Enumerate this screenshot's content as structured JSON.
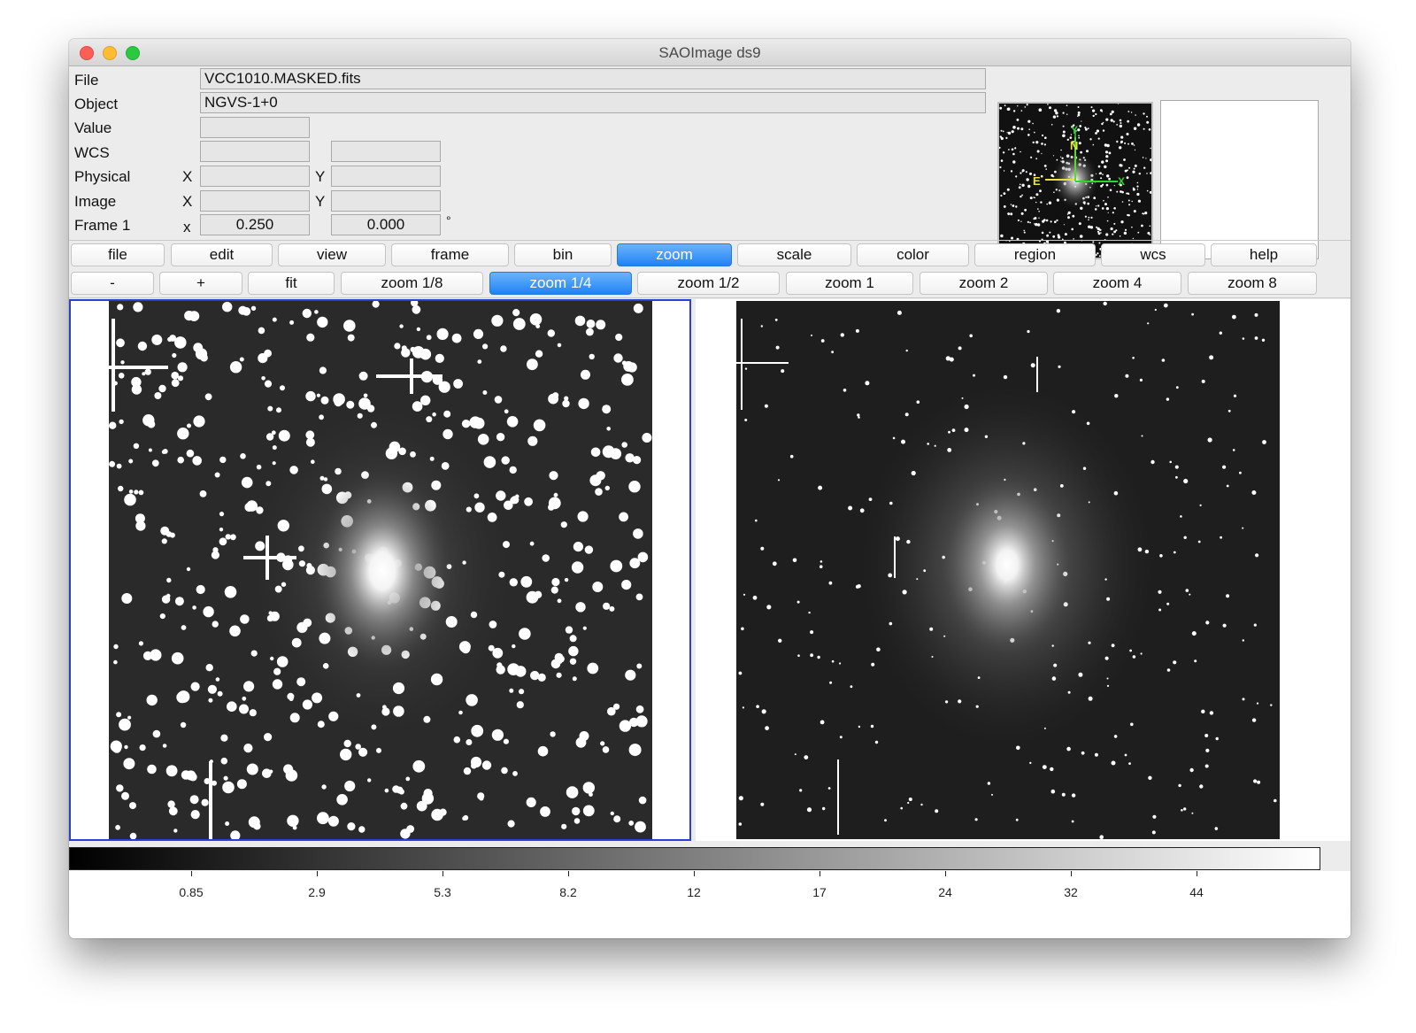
{
  "window": {
    "title": "SAOImage ds9"
  },
  "info": {
    "file_label": "File",
    "file_value": "VCC1010.MASKED.fits",
    "object_label": "Object",
    "object_value": "NGVS-1+0",
    "value_label": "Value",
    "value_value": "",
    "wcs_label": "WCS",
    "wcs_value1": "",
    "wcs_value2": "",
    "physical_label": "Physical",
    "physical_x_label": "X",
    "physical_x_value": "",
    "physical_y_label": "Y",
    "physical_y_value": "",
    "image_label": "Image",
    "image_x_label": "X",
    "image_x_value": "",
    "image_y_label": "Y",
    "image_y_value": "",
    "frame_label": "Frame 1",
    "frame_x_label": "x",
    "frame_zoom_value": "0.250",
    "frame_angle_value": "0.000",
    "frame_angle_unit": "°"
  },
  "panner": {
    "compass": {
      "north": "N",
      "east": "E",
      "x_axis": "X",
      "y_axis": "Y"
    }
  },
  "main_menu": [
    {
      "label": "file",
      "active": false
    },
    {
      "label": "edit",
      "active": false
    },
    {
      "label": "view",
      "active": false
    },
    {
      "label": "frame",
      "active": false
    },
    {
      "label": "bin",
      "active": false
    },
    {
      "label": "zoom",
      "active": true
    },
    {
      "label": "scale",
      "active": false
    },
    {
      "label": "color",
      "active": false
    },
    {
      "label": "region",
      "active": false
    },
    {
      "label": "wcs",
      "active": false
    },
    {
      "label": "help",
      "active": false
    }
  ],
  "zoom_buttons": [
    {
      "label": "-",
      "active": false
    },
    {
      "label": "+",
      "active": false
    },
    {
      "label": "fit",
      "active": false
    },
    {
      "label": "zoom 1/8",
      "active": false
    },
    {
      "label": "zoom 1/4",
      "active": true
    },
    {
      "label": "zoom 1/2",
      "active": false
    },
    {
      "label": "zoom 1",
      "active": false
    },
    {
      "label": "zoom 2",
      "active": false
    },
    {
      "label": "zoom 4",
      "active": false
    },
    {
      "label": "zoom 8",
      "active": false
    }
  ],
  "colorbar": {
    "ticks": [
      "0.85",
      "2.9",
      "5.3",
      "8.2",
      "12",
      "17",
      "24",
      "32",
      "44"
    ],
    "colors": {
      "low": "#000000",
      "high": "#ffffff"
    }
  },
  "colors": {
    "accent": "#1f83f5",
    "current_frame_border": "#2b3fd6",
    "compass_n": "#e8e23a",
    "compass_x": "#2fd52f"
  }
}
